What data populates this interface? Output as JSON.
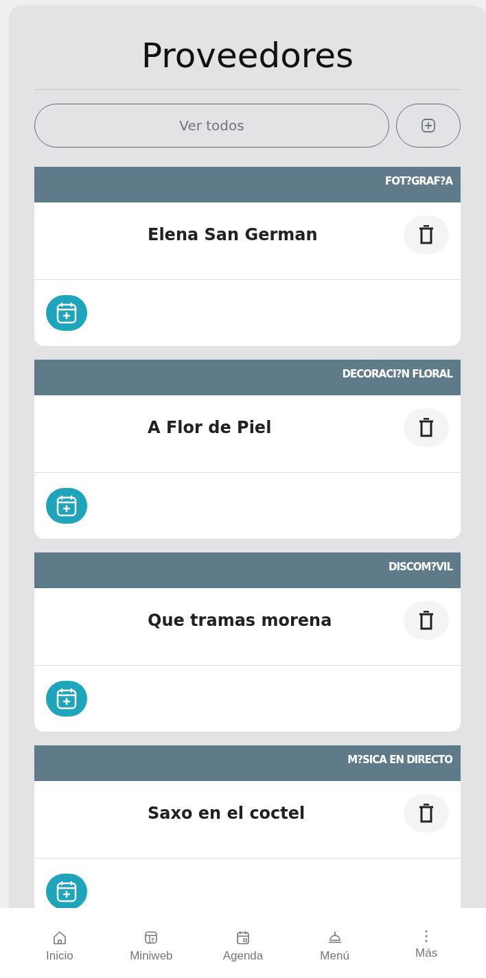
{
  "title": "Proveedores",
  "filter_button": {
    "label": "Ver todos"
  },
  "providers": [
    {
      "category": "FOT?GRAF?A",
      "name": "Elena San German"
    },
    {
      "category": "DECORACI?N FLORAL",
      "name": "A Flor de Piel"
    },
    {
      "category": "DISCOM?VIL",
      "name": "Que tramas morena"
    },
    {
      "category": "M?SICA EN DIRECTO",
      "name": "Saxo en el coctel"
    }
  ],
  "nav": [
    {
      "kind": "home",
      "label": "Inicio"
    },
    {
      "kind": "web",
      "label": "Miniweb"
    },
    {
      "kind": "calendar",
      "label": "Agenda"
    },
    {
      "kind": "cloche",
      "label": "Menú"
    },
    {
      "kind": "more",
      "label": "Más"
    }
  ]
}
